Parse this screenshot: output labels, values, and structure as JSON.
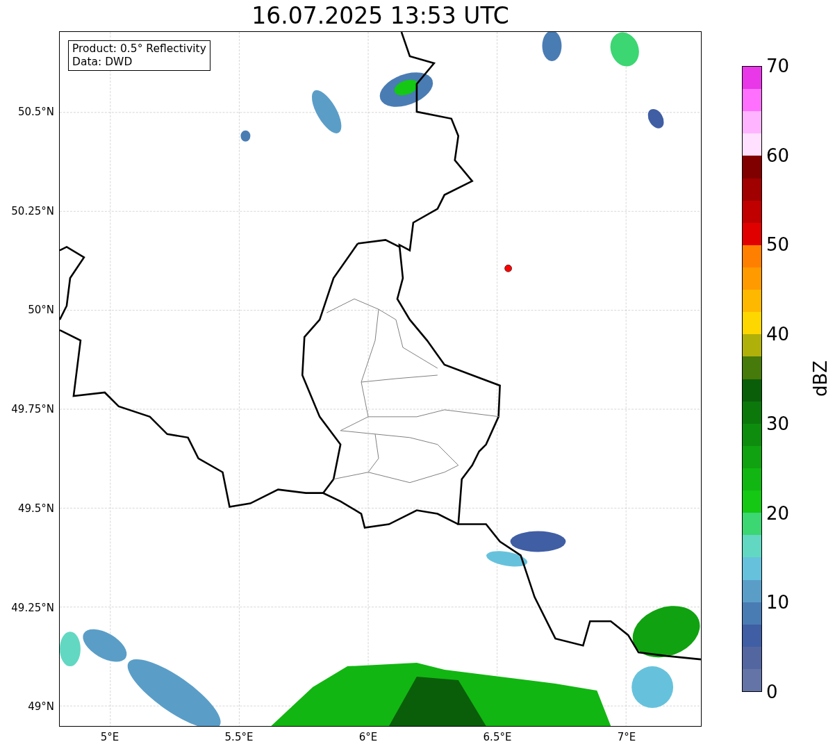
{
  "title": "16.07.2025 13:53 UTC",
  "info_box": {
    "lines": [
      "Product: 0.5° Reflectivity",
      "Data: DWD"
    ]
  },
  "map": {
    "y_ticks": [
      "50.5°N",
      "50.25°N",
      "50°N",
      "49.75°N",
      "49.5°N",
      "49.25°N",
      "49°N"
    ],
    "x_ticks": [
      "5°E",
      "5.5°E",
      "6°E",
      "6.5°E",
      "7°E"
    ]
  },
  "colorbar": {
    "label": "dBZ",
    "ticks": [
      "70",
      "60",
      "50",
      "40",
      "30",
      "20",
      "10",
      "0"
    ],
    "bands": [
      {
        "color": "#e838e8"
      },
      {
        "color": "#ff70ff"
      },
      {
        "color": "#ffb4ff"
      },
      {
        "color": "#ffe0ff"
      },
      {
        "color": "#800000"
      },
      {
        "color": "#a00000"
      },
      {
        "color": "#c00000"
      },
      {
        "color": "#e00000"
      },
      {
        "color": "#ff8000"
      },
      {
        "color": "#ff9a00"
      },
      {
        "color": "#ffb800"
      },
      {
        "color": "#ffd700"
      },
      {
        "color": "#b0b00a"
      },
      {
        "color": "#467a0a"
      },
      {
        "color": "#0a5e0a"
      },
      {
        "color": "#0c780c"
      },
      {
        "color": "#0e8c0e"
      },
      {
        "color": "#10a210"
      },
      {
        "color": "#12b612"
      },
      {
        "color": "#14c814"
      },
      {
        "color": "#3cd672"
      },
      {
        "color": "#62d8c2"
      },
      {
        "color": "#66c2dc"
      },
      {
        "color": "#5a9ec8"
      },
      {
        "color": "#4a7cb4"
      },
      {
        "color": "#405ea4"
      },
      {
        "color": "#5466a0"
      },
      {
        "color": "#6474a6"
      }
    ]
  }
}
